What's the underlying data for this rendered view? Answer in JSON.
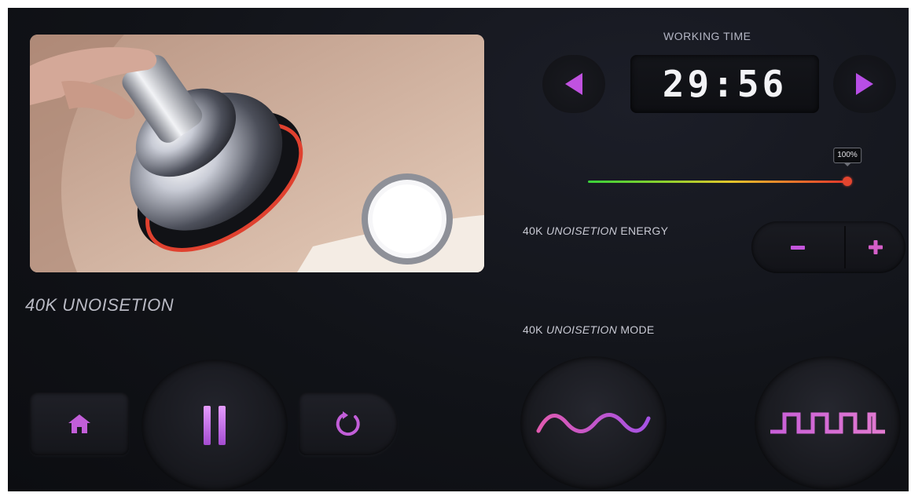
{
  "colors": {
    "accent": "#b45ae0",
    "accent_light": "#e69bff",
    "background": "#111318"
  },
  "treatment": {
    "caption": "40K UNOISETION"
  },
  "controls": {
    "home_icon": "home-icon",
    "pause_icon": "pause-icon",
    "replay_icon": "replay-icon"
  },
  "working_time": {
    "label": "WORKING TIME",
    "value": "29:56"
  },
  "energy": {
    "label_prefix": "40K ",
    "label_em": "UNOISETION",
    "label_suffix": " ENERGY",
    "level_text": "100%",
    "level": 1.0,
    "minus": "−",
    "plus": "+"
  },
  "mode": {
    "label_prefix": "40K ",
    "label_em": "UNOISETION",
    "label_suffix": " MODE",
    "options": [
      {
        "icon": "sine-wave-icon"
      },
      {
        "icon": "square-wave-icon"
      }
    ]
  }
}
